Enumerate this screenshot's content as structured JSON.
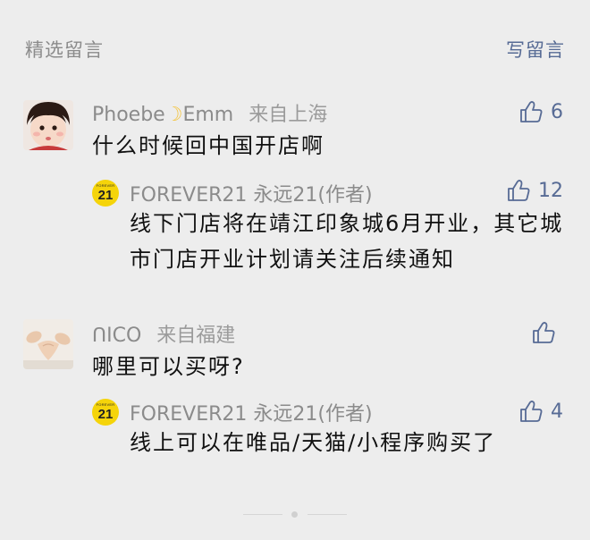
{
  "header": {
    "title": "精选留言",
    "write_action": "写留言"
  },
  "comments": [
    {
      "author": "Phoebe",
      "author_suffix": "Emm",
      "location": "来自上海",
      "text": "什么时候回中国开店啊",
      "likes": "6",
      "reply": {
        "avatar_small": "FOREVER",
        "avatar_big": "21",
        "author": "FOREVER21 永远21(作者)",
        "text": "线下门店将在靖江印象城6月开业，其它城市门店开业计划请关注后续通知",
        "likes": "12"
      }
    },
    {
      "author": "ᑎICO",
      "location": "来自福建",
      "text": "哪里可以买呀?",
      "likes": "",
      "reply": {
        "avatar_small": "FOREVER",
        "avatar_big": "21",
        "author": "FOREVER21 永远21(作者)",
        "text": "线上可以在唯品/天猫/小程序购买了",
        "likes": "4"
      }
    }
  ],
  "colors": {
    "background": "#ededed",
    "link": "#576b95",
    "muted": "#8b8b8b",
    "brand_yellow": "#f5d40a"
  },
  "icons": [
    "thumbs-up-icon",
    "moon-emoji",
    "forever21-logo"
  ]
}
